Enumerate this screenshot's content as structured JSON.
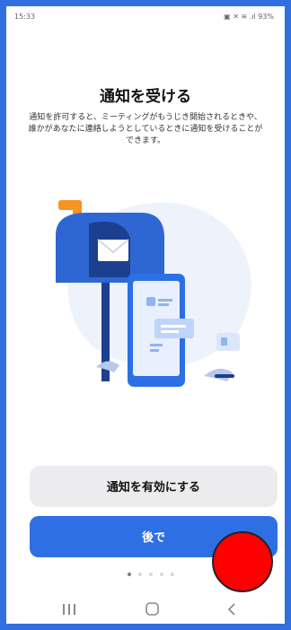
{
  "status_bar": {
    "time": "15:33",
    "time_extra": "••",
    "indicators": "▣ ✕ ≋ .ıl 93%",
    "battery": "93%"
  },
  "screen": {
    "title": "通知を受ける",
    "description": "通知を許可すると、ミーティングがもうじき開始されるときや、誰かがあなたに連絡しようとしているときに通知を受けることができます。"
  },
  "buttons": {
    "enable_label": "通知を有効にする",
    "later_label": "後で"
  },
  "pagination": {
    "total": 5,
    "active_index": 0
  },
  "colors": {
    "frame": "#2f6fe0",
    "primary": "#2e6fe4",
    "secondary_button": "#ececee",
    "mailbox_blue": "#2e66d4",
    "flag_orange": "#f7931e",
    "marker": "#ff0000"
  },
  "nav": {
    "icons": [
      "recent-apps-icon",
      "home-icon",
      "back-icon"
    ]
  }
}
